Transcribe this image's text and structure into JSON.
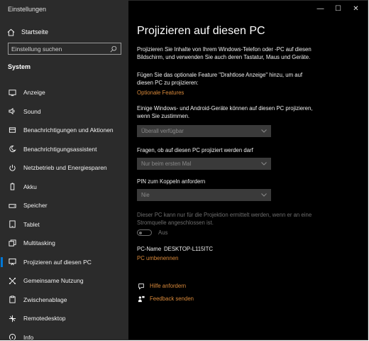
{
  "window": {
    "title": "Einstellungen",
    "controls": {
      "minimize": "—",
      "maximize": "☐",
      "close": "✕"
    }
  },
  "sidebar": {
    "home": {
      "label": "Startseite",
      "icon": "home-icon"
    },
    "search": {
      "placeholder": "Einstellung suchen",
      "icon": "search-icon"
    },
    "section_title": "System",
    "items": [
      {
        "label": "Anzeige",
        "icon": "monitor-icon"
      },
      {
        "label": "Sound",
        "icon": "speaker-icon"
      },
      {
        "label": "Benachrichtigungen und Aktionen",
        "icon": "notification-icon"
      },
      {
        "label": "Benachrichtigungsassistent",
        "icon": "moon-icon"
      },
      {
        "label": "Netzbetrieb und Energiesparen",
        "icon": "power-icon"
      },
      {
        "label": "Akku",
        "icon": "battery-icon"
      },
      {
        "label": "Speicher",
        "icon": "storage-icon"
      },
      {
        "label": "Tablet",
        "icon": "tablet-icon"
      },
      {
        "label": "Multitasking",
        "icon": "multitasking-icon"
      },
      {
        "label": "Projizieren auf diesen PC",
        "icon": "project-icon",
        "active": true
      },
      {
        "label": "Gemeinsame Nutzung",
        "icon": "shared-experiences-icon"
      },
      {
        "label": "Zwischenablage",
        "icon": "clipboard-icon"
      },
      {
        "label": "Remotedesktop",
        "icon": "remote-desktop-icon"
      },
      {
        "label": "Info",
        "icon": "info-icon"
      }
    ]
  },
  "main": {
    "title": "Projizieren auf diesen PC",
    "intro": "Projizieren Sie Inhalte von Ihrem Windows-Telefon oder -PC auf diesen Bildschirm, und verwenden Sie auch deren Tastatur, Maus und Geräte.",
    "feature_text": "Fügen Sie das optionale Feature \"Drahtlose Anzeige\" hinzu, um auf diesen PC zu projizieren:",
    "optional_features_link": "Optionale Features",
    "permission_text": "Einige Windows- und Android-Geräte können auf diesen PC projizieren, wenn Sie zustimmen.",
    "dropdown1": {
      "value": "Überall verfügbar"
    },
    "dropdown2": {
      "label": "Fragen, ob auf diesen PC projiziert werden darf",
      "value": "Nur beim ersten Mal"
    },
    "dropdown3": {
      "label": "PIN zum Koppeln anfordern",
      "value": "Nie"
    },
    "power_text": "Dieser PC kann nur für die Projektion ermittelt werden, wenn er an eine Stromquelle angeschlossen ist.",
    "toggle": {
      "state": "Aus",
      "on": false
    },
    "pc_name_label": "PC-Name",
    "pc_name_value": "DESKTOP-L115ITC",
    "rename_link": "PC umbenennen",
    "help_link": "Hilfe anfordern",
    "feedback_link": "Feedback senden",
    "accent_color": "#d9893a"
  }
}
